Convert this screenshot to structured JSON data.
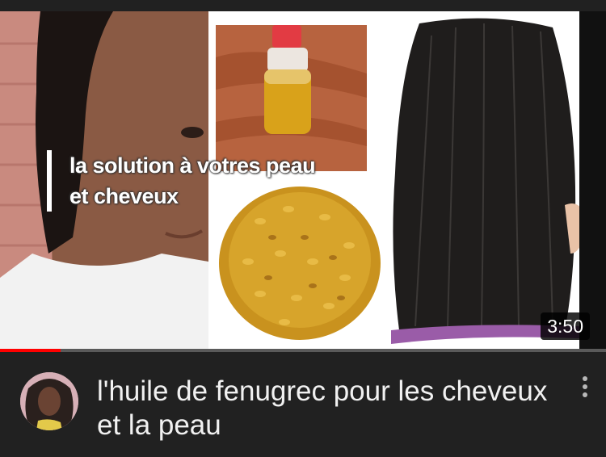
{
  "video": {
    "overlay_text_line1": "la solution à votres peau",
    "overlay_text_line2": "et cheveux",
    "duration": "3:50",
    "watched_fraction": 0.1,
    "title": "l'huile de  fenugrec pour les cheveux et la peau"
  },
  "icons": {
    "menu": "more-vert-icon"
  },
  "colors": {
    "background": "#212121",
    "progress": "#ff0000",
    "title": "#f1f1f1"
  }
}
